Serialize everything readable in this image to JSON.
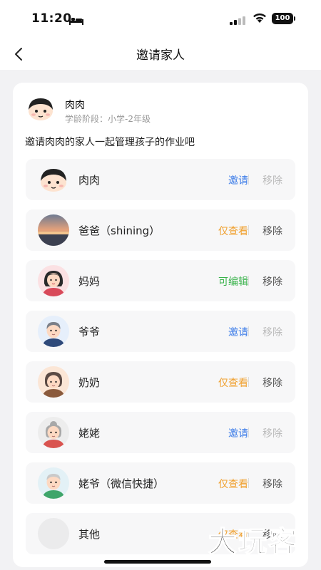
{
  "status_bar": {
    "time": "11:20",
    "battery": "100"
  },
  "nav": {
    "title": "邀请家人"
  },
  "child": {
    "name": "肉肉",
    "stage": "学龄阶段：小学-2年级"
  },
  "intro": "邀请肉肉的家人一起管理孩子的作业吧",
  "members": [
    {
      "name": "肉肉",
      "action": "邀请",
      "action_color": "#3a7be8",
      "remove": "移除",
      "remove_enabled": false,
      "avatar": "boy-cartoon-avatar"
    },
    {
      "name": "爸爸（shining）",
      "action": "仅查看",
      "action_color": "#f0a02e",
      "remove": "移除",
      "remove_enabled": true,
      "avatar": "sunset-photo-avatar"
    },
    {
      "name": "妈妈",
      "action": "可编辑",
      "action_color": "#38b24a",
      "remove": "移除",
      "remove_enabled": true,
      "avatar": "mom-avatar"
    },
    {
      "name": "爷爷",
      "action": "邀请",
      "action_color": "#3a7be8",
      "remove": "移除",
      "remove_enabled": false,
      "avatar": "grandpa-avatar"
    },
    {
      "name": "奶奶",
      "action": "仅查看",
      "action_color": "#f0a02e",
      "remove": "移除",
      "remove_enabled": true,
      "avatar": "grandma-avatar"
    },
    {
      "name": "姥姥",
      "action": "邀请",
      "action_color": "#3a7be8",
      "remove": "移除",
      "remove_enabled": false,
      "avatar": "maternal-grandma-avatar"
    },
    {
      "name": "姥爷（微信快捷）",
      "action": "仅查看",
      "action_color": "#f0a02e",
      "remove": "移除",
      "remove_enabled": true,
      "avatar": "maternal-grandpa-avatar"
    },
    {
      "name": "其他",
      "action": "仅查看",
      "action_color": "#f0a02e",
      "remove": "移除",
      "remove_enabled": true,
      "avatar": "blank-avatar"
    }
  ],
  "watermark": "大玩客"
}
